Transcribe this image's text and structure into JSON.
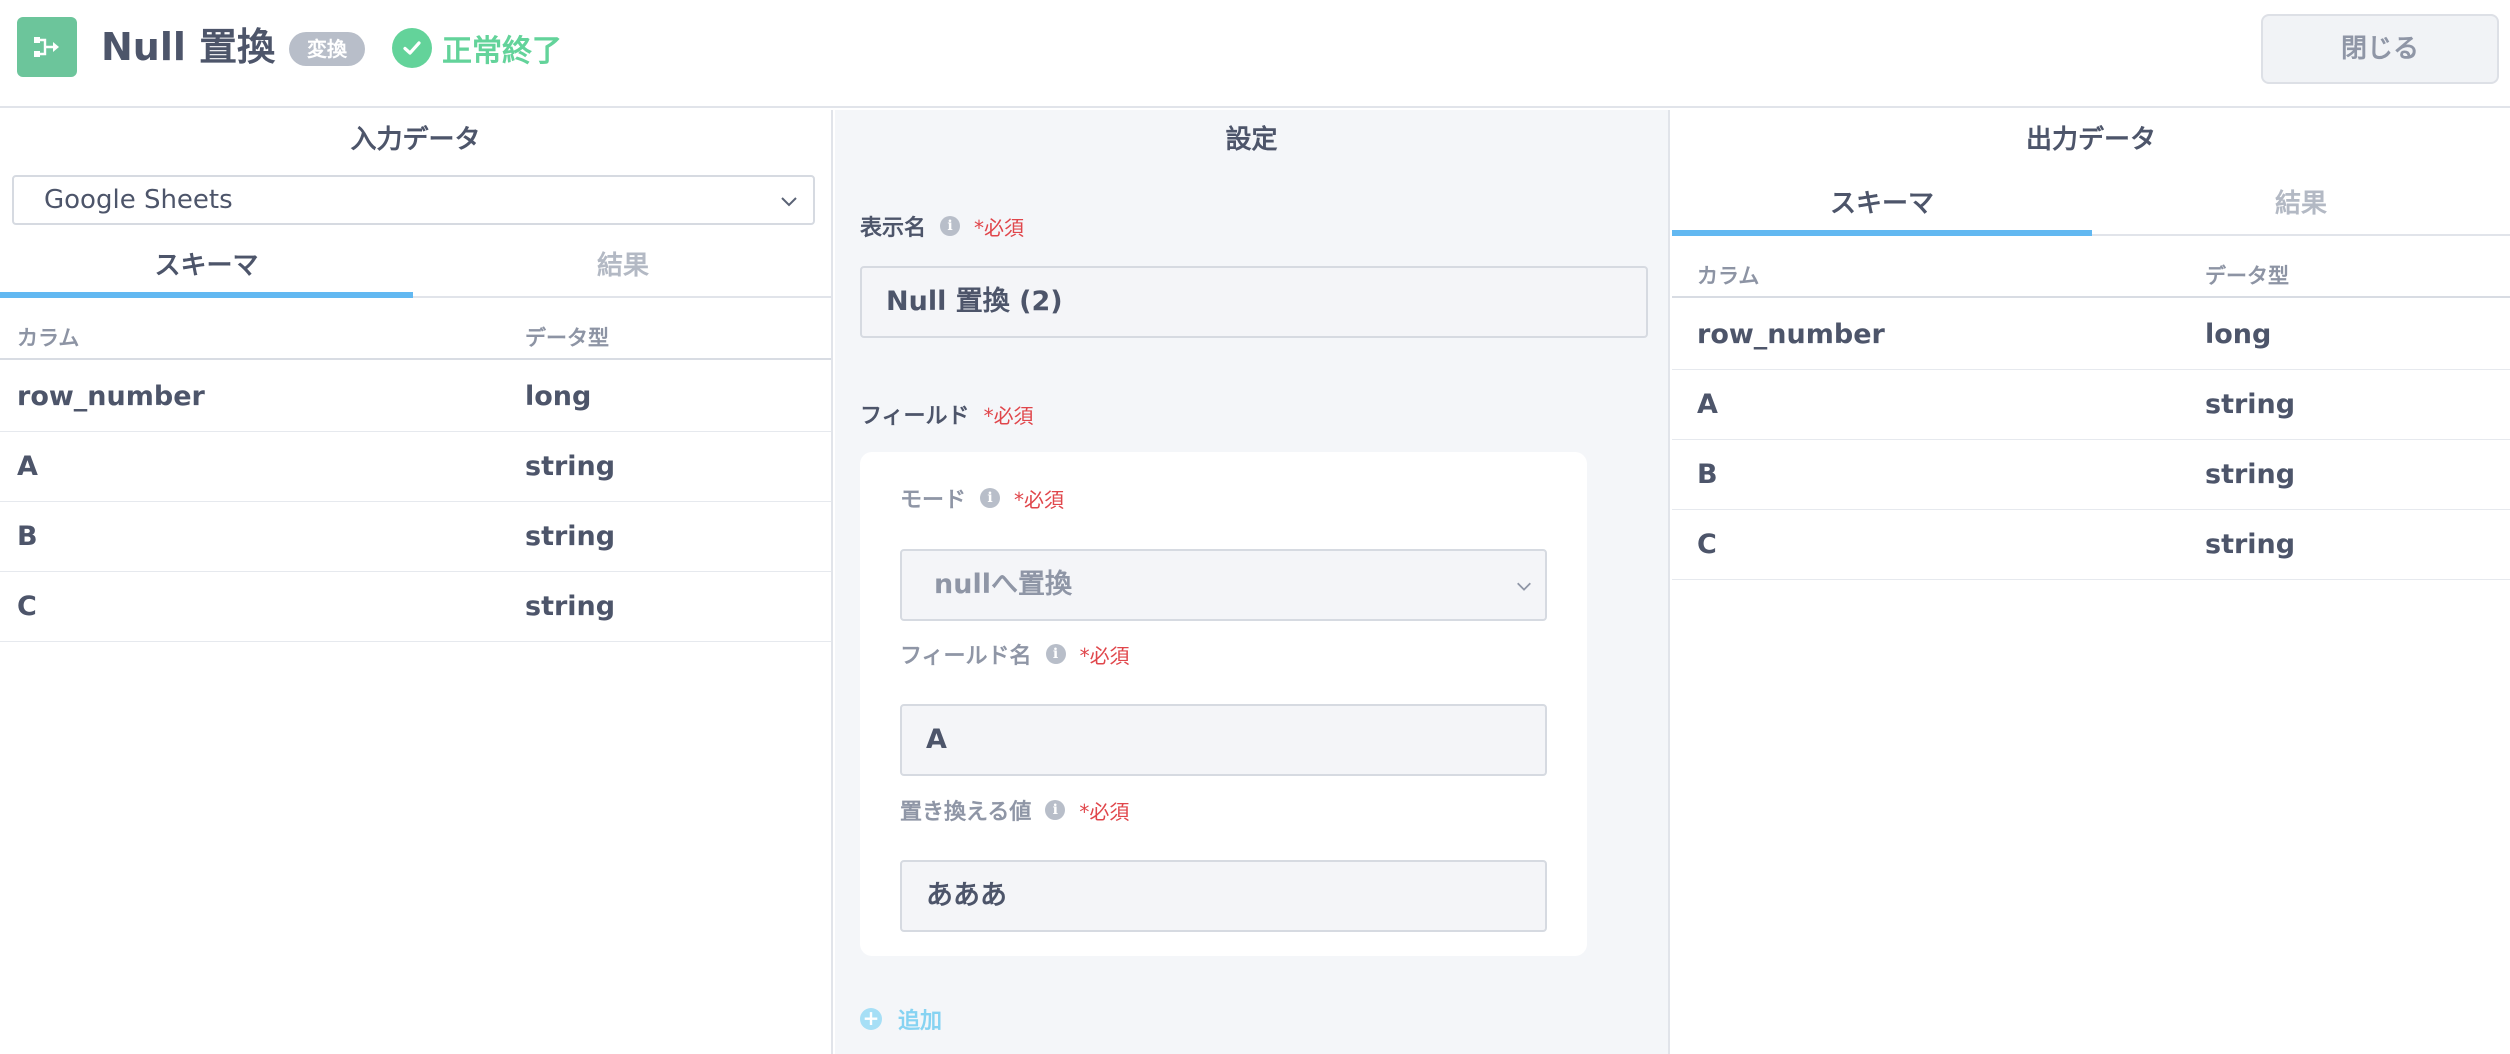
{
  "header": {
    "title": "Null 置換",
    "type_badge": "変換",
    "status": "正常終了",
    "close_label": "閉じる",
    "app_icon": "flow-icon",
    "status_icon": "check-circle-icon",
    "colors": {
      "icon_bg": "#6cc59b",
      "success": "#63d39a",
      "tab_active": "#62b8f1",
      "required": "#e0464b"
    }
  },
  "input_panel": {
    "title": "入力データ",
    "source_select": "Google Sheets",
    "tabs": [
      {
        "label": "スキーマ",
        "active": true
      },
      {
        "label": "結果",
        "active": false
      }
    ],
    "columns": [
      "カラム",
      "データ型"
    ],
    "rows": [
      [
        "row_number",
        "long"
      ],
      [
        "A",
        "string"
      ],
      [
        "B",
        "string"
      ],
      [
        "C",
        "string"
      ]
    ]
  },
  "settings_panel": {
    "title": "設定",
    "display_name_label": "表示名",
    "required": "*必須",
    "display_name_value": "Null 置換 (2)",
    "fields_label": "フィールド",
    "mode_label": "モード",
    "mode_value": "nullへ置換",
    "field_name_label": "フィールド名",
    "field_name_value": "A",
    "replace_value_label": "置き換える値",
    "replace_value": "あああ",
    "add_label": "追加"
  },
  "output_panel": {
    "title": "出力データ",
    "tabs": [
      {
        "label": "スキーマ",
        "active": true
      },
      {
        "label": "結果",
        "active": false
      }
    ],
    "columns": [
      "カラム",
      "データ型"
    ],
    "rows": [
      [
        "row_number",
        "long"
      ],
      [
        "A",
        "string"
      ],
      [
        "B",
        "string"
      ],
      [
        "C",
        "string"
      ]
    ]
  }
}
